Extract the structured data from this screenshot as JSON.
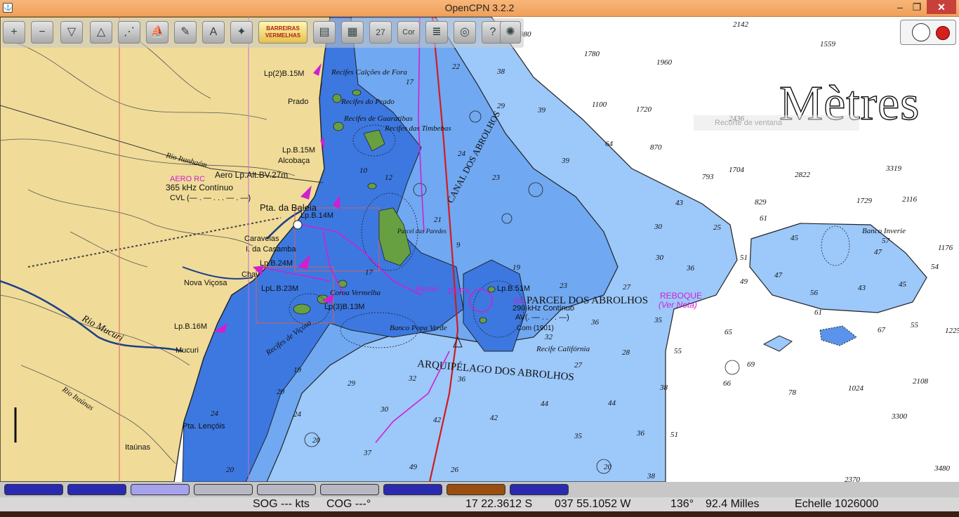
{
  "window": {
    "title": "OpenCPN 3.2.2",
    "minimize": "–",
    "maximize": "❐",
    "close": "✕"
  },
  "toolbar": {
    "barreiras_label": "BARREIRAS VERMELHAS",
    "tools": [
      {
        "name": "zoom-in-tool",
        "glyph": "+"
      },
      {
        "name": "zoom-out-tool",
        "glyph": "−"
      },
      {
        "name": "scale-down-tool",
        "glyph": "▽"
      },
      {
        "name": "scale-up-tool",
        "glyph": "△"
      },
      {
        "name": "route-tool",
        "glyph": "⋰"
      },
      {
        "name": "auto-follow-tool",
        "glyph": "⛵"
      },
      {
        "name": "settings-tool",
        "glyph": "✎"
      },
      {
        "name": "text-tool",
        "glyph": "A"
      },
      {
        "name": "show-currents-tool",
        "glyph": "✦"
      }
    ],
    "tools_right": [
      {
        "name": "print-tool",
        "glyph": "▤"
      },
      {
        "name": "ais-tool",
        "glyph": "▦"
      },
      {
        "name": "cm93-tool",
        "glyph": "27"
      },
      {
        "name": "color-tool",
        "glyph": "Cor"
      },
      {
        "name": "layers-tool",
        "glyph": "≣"
      },
      {
        "name": "mob-tool",
        "glyph": "◎"
      },
      {
        "name": "help-tool",
        "glyph": "?"
      },
      {
        "name": "plugin-tool",
        "glyph": "✺"
      }
    ]
  },
  "overlay": {
    "units": "Mètres",
    "tooltip": "Recorte de ventana"
  },
  "chart_labels": {
    "recifes_calcoes": "Recifes Calções de Fora",
    "recifes_prado": "Recifes do Prado",
    "recifes_guaratibas": "Recifes de Guaratibas",
    "recifes_timbebas": "Recifes das Timbebas",
    "canal": "CANAL DOS ABROLHOS",
    "parcel_paredes": "Parcel das Paredes",
    "parcel_abrolhos": "PARCEL DOS ABROLHOS",
    "arquipelago": "ARQUIPÉLAGO DOS ABROLHOS",
    "recife_california": "Recife Califórnia",
    "banco_popa": "Banco Popa Verde",
    "coroa": "Coroa Vermelha",
    "recifes_vicosa": "Recifes de Viçosa",
    "banco_inverie": "Banco Inverie",
    "reboque": "REBOQUE",
    "ver_nota": "(Ver Nota)",
    "recon": "Recon",
    "dgps": "DGPS",
    "rc": "RC",
    "aero_rc": "AERO RC",
    "aero_light": "Aero Lp.Alt.BV.27m",
    "khz_365": "365 kHz Contínuo",
    "cvl": "CVL (— . — . . . — . —)",
    "khz_290": "290 kHz Contínuo",
    "av": "AV(. — . . . . —)",
    "com": "Com (1901)",
    "pta_baleia": "Pta. da Baleia",
    "caravelas": "Caravelas",
    "casamba": "I. da Casamba",
    "nova_vicosa": "Nova Viçosa",
    "mucuri": "Mucuri",
    "rio_mucuri": "Rio Mucuri",
    "rio_itanhaem": "Rio Itanhaém",
    "rio_itaunas": "Rio Itaúnas",
    "itaunas": "Itaúnas",
    "pta_lencois": "Pta. Lençóis",
    "prado": "Prado",
    "alcobaca": "Alcobaça",
    "chav": "Chav",
    "lp2": "Lp(2)B.15M",
    "lpb15": "Lp.B.15M",
    "lpb14": "Lp.B.14M",
    "lpb24": "Lp.B.24M",
    "lpl23": "LpL.B.23M",
    "lp3": "Lp(3)B.13M",
    "lpb16": "Lp.B.16M",
    "lpb51": "Lp.B.51M"
  },
  "depths": [
    [
      "980",
      740,
      52
    ],
    [
      "2142",
      1044,
      38
    ],
    [
      "1559",
      1168,
      66
    ],
    [
      "1780",
      832,
      80
    ],
    [
      "1960",
      935,
      92
    ],
    [
      "1100",
      843,
      152
    ],
    [
      "1720",
      906,
      159
    ],
    [
      "2436",
      1038,
      172
    ],
    [
      "870",
      926,
      213
    ],
    [
      "64",
      862,
      208
    ],
    [
      "1704",
      1038,
      245
    ],
    [
      "2822",
      1132,
      252
    ],
    [
      "3319",
      1262,
      243
    ],
    [
      "793",
      1000,
      255
    ],
    [
      "829",
      1075,
      291
    ],
    [
      "1729",
      1220,
      289
    ],
    [
      "2116",
      1285,
      287
    ],
    [
      "61",
      1082,
      314
    ],
    [
      "25",
      1016,
      327
    ],
    [
      "57",
      1256,
      346
    ],
    [
      "1176",
      1336,
      356
    ],
    [
      "45",
      1126,
      342
    ],
    [
      "47",
      1245,
      362
    ],
    [
      "51",
      1054,
      370
    ],
    [
      "54",
      1326,
      383
    ],
    [
      "47",
      1103,
      395
    ],
    [
      "56",
      1154,
      420
    ],
    [
      "43",
      1222,
      413
    ],
    [
      "45",
      1280,
      408
    ],
    [
      "61",
      1160,
      448
    ],
    [
      "55",
      1297,
      466
    ],
    [
      "1225",
      1346,
      474
    ],
    [
      "65",
      1032,
      476
    ],
    [
      "67",
      1250,
      473
    ],
    [
      "69",
      1064,
      522
    ],
    [
      "66",
      1030,
      549
    ],
    [
      "78",
      1123,
      562
    ],
    [
      "1024",
      1208,
      556
    ],
    [
      "2108",
      1300,
      546
    ],
    [
      "3300",
      1270,
      596
    ],
    [
      "3480",
      1331,
      670
    ],
    [
      "2370",
      1203,
      686
    ],
    [
      "22",
      644,
      98
    ],
    [
      "38",
      708,
      105
    ],
    [
      "17",
      578,
      120
    ],
    [
      "29",
      708,
      154
    ],
    [
      "39",
      766,
      160
    ],
    [
      "24",
      652,
      222
    ],
    [
      "23",
      701,
      256
    ],
    [
      "39",
      800,
      232
    ],
    [
      "43",
      962,
      292
    ],
    [
      "30",
      932,
      326
    ],
    [
      "30",
      934,
      370
    ],
    [
      "36",
      978,
      385
    ],
    [
      "49",
      1054,
      404
    ],
    [
      "23",
      797,
      410
    ],
    [
      "27",
      887,
      412
    ],
    [
      "32",
      776,
      483
    ],
    [
      "28",
      886,
      505
    ],
    [
      "27",
      818,
      523
    ],
    [
      "36",
      842,
      462
    ],
    [
      "35",
      932,
      459
    ],
    [
      "55",
      960,
      503
    ],
    [
      "38",
      940,
      555
    ],
    [
      "44",
      770,
      578
    ],
    [
      "44",
      866,
      577
    ],
    [
      "35",
      818,
      624
    ],
    [
      "36",
      907,
      620
    ],
    [
      "51",
      955,
      622
    ],
    [
      "38",
      922,
      681
    ],
    [
      "20",
      860,
      668
    ],
    [
      "26",
      642,
      672
    ],
    [
      "49",
      583,
      668
    ],
    [
      "37",
      518,
      648
    ],
    [
      "42",
      698,
      598
    ],
    [
      "42",
      617,
      601
    ],
    [
      "30",
      542,
      586
    ],
    [
      "36",
      652,
      543
    ],
    [
      "29",
      495,
      549
    ],
    [
      "32",
      582,
      542
    ],
    [
      "20",
      394,
      561
    ],
    [
      "24",
      418,
      593
    ],
    [
      "20",
      445,
      630
    ],
    [
      "20",
      322,
      672
    ],
    [
      "19",
      418,
      530
    ],
    [
      "10",
      512,
      246
    ],
    [
      "12",
      548,
      256
    ],
    [
      "21",
      618,
      316
    ],
    [
      "9",
      650,
      352
    ],
    [
      "19",
      730,
      384
    ],
    [
      "17",
      520,
      391
    ],
    [
      "24",
      300,
      592
    ]
  ],
  "piano": [
    {
      "color": "#2a2ab0"
    },
    {
      "color": "#2a2ab0"
    },
    {
      "color": "#a7a2ec"
    },
    {
      "color": "#b8b8c4"
    },
    {
      "color": "#b8b8c4"
    },
    {
      "color": "#b8b8c4"
    },
    {
      "color": "#2a2ab0"
    },
    {
      "color": "#9a4e10"
    },
    {
      "color": "#2a2ab0"
    }
  ],
  "status": {
    "sog": "SOG --- kts",
    "cog": "COG ---°",
    "lat": "17 22.3612 S",
    "lon": "037 55.1052 W",
    "bearing": "136°",
    "distance": "92.4 Milles",
    "scale": "Echelle 1026000"
  },
  "colors": {
    "land": "#f0dc98",
    "shallow": "#3c78e0",
    "mid": "#70a8f2",
    "deep": "#9cc8fa",
    "ocean": "#ffffff",
    "reef": "#66a040",
    "route": "#d21c1c",
    "magenta": "#d020d0"
  }
}
